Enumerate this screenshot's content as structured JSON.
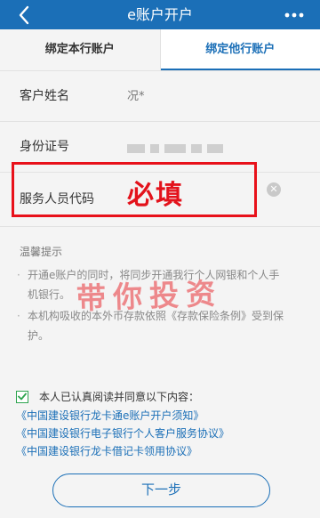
{
  "navbar": {
    "title": "e账户开户",
    "back_icon": "chevron-left-icon",
    "more_icon": "more-dots-icon",
    "background": "#1b6fb7"
  },
  "tabs": [
    {
      "label": "绑定本行账户",
      "active": true
    },
    {
      "label": "绑定他行账户",
      "active": false
    }
  ],
  "form": {
    "name_label": "客户姓名",
    "name_value": "况*",
    "id_label": "身份证号",
    "staff_code_label": "服务人员代码",
    "staff_code_value": "",
    "clear_icon": "clear-icon"
  },
  "overlay": {
    "required_note": "必填",
    "highlight_color": "#e8111a"
  },
  "tips": {
    "title": "温馨提示",
    "items": [
      "开通e账户的同时，将同步开通我行个人网银和个人手机银行。",
      "本机构吸收的本外币存款依照《存款保险条例》受到保护。"
    ]
  },
  "watermark": "带你投资",
  "agreement": {
    "checked": true,
    "text": "本人已认真阅读并同意以下内容：",
    "links": [
      "《中国建设银行龙卡通e账户开户须知》",
      "《中国建设银行电子银行个人客户服务协议》",
      "《中国建设银行龙卡借记卡领用协议》"
    ]
  },
  "next_button": "下一步"
}
